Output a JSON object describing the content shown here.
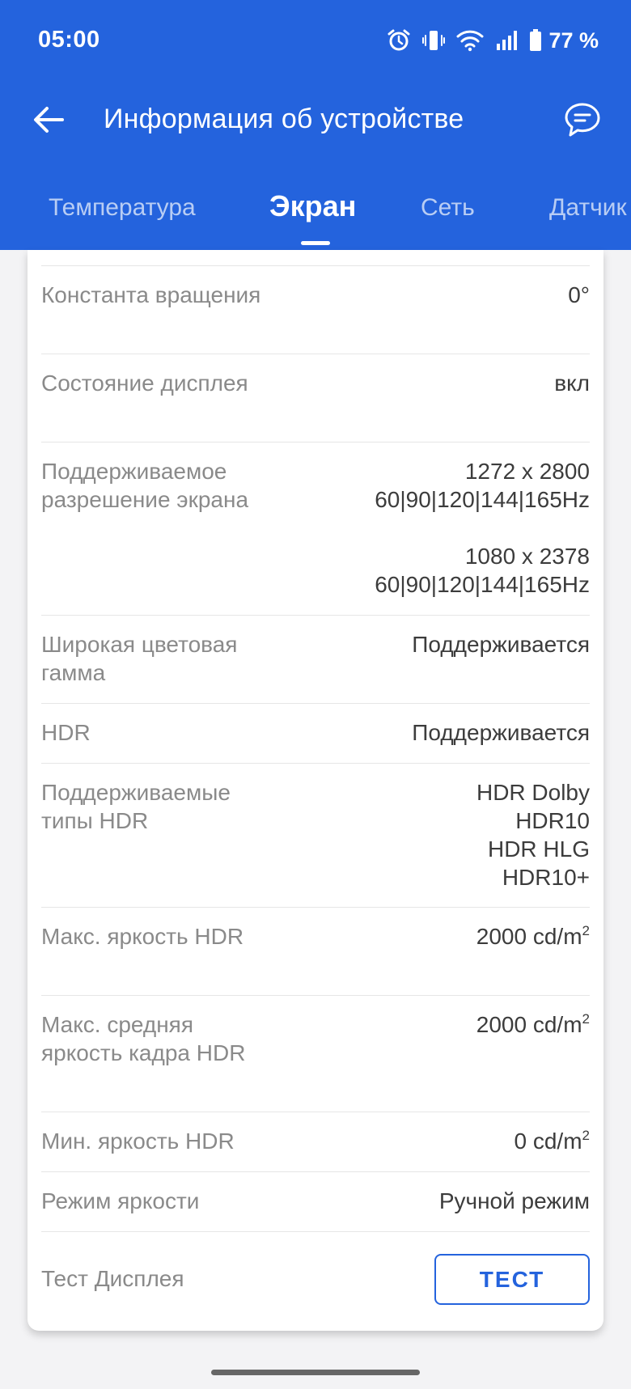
{
  "status_bar": {
    "time": "05:00",
    "battery": "77 %",
    "icons": [
      "alarm-icon",
      "vibrate-icon",
      "wifi-icon",
      "signal-icon",
      "battery-icon"
    ]
  },
  "app_bar": {
    "title": "Информация об устройстве",
    "back_icon": "arrow-left-icon",
    "feedback_icon": "chat-bubble-icon"
  },
  "tabs": [
    {
      "label": "Температура",
      "active": false
    },
    {
      "label": "Экран",
      "active": true
    },
    {
      "label": "Сеть",
      "active": false
    },
    {
      "label": "Датчик",
      "active": false
    }
  ],
  "rows": [
    {
      "label": "Константа вращения",
      "value": [
        "0°"
      ]
    },
    {
      "label": "Состояние дисплея",
      "value": [
        "вкл"
      ]
    },
    {
      "label": "Поддерживаемое разрешение экрана",
      "value": [
        "1272 x 2800",
        "60|90|120|144|165Hz",
        "",
        "1080 x 2378",
        "60|90|120|144|165Hz"
      ]
    },
    {
      "label": "Широкая цветовая гамма",
      "value": [
        "Поддерживается"
      ]
    },
    {
      "label": "HDR",
      "value": [
        "Поддерживается"
      ]
    },
    {
      "label": "Поддерживаемые типы HDR",
      "value": [
        "HDR Dolby",
        "HDR10",
        "HDR HLG",
        "HDR10+"
      ]
    },
    {
      "label": "Макс. яркость HDR",
      "value": [
        "2000 cd/m"
      ],
      "unit_sup": "2"
    },
    {
      "label": "Макс. средняя яркость кадра HDR",
      "value": [
        "2000 cd/m"
      ],
      "unit_sup": "2"
    },
    {
      "label": "Мин. яркость HDR",
      "value": [
        "0 cd/m"
      ],
      "unit_sup": "2"
    },
    {
      "label": "Режим яркости",
      "value": [
        "Ручной режим"
      ]
    },
    {
      "label": "Тест Дисплея",
      "button": "ТЕСТ"
    }
  ],
  "colors": {
    "primary": "#2463dd",
    "label": "#8a8a8a",
    "value": "#3c3c3c",
    "background": "#f3f3f5",
    "card": "#ffffff"
  }
}
